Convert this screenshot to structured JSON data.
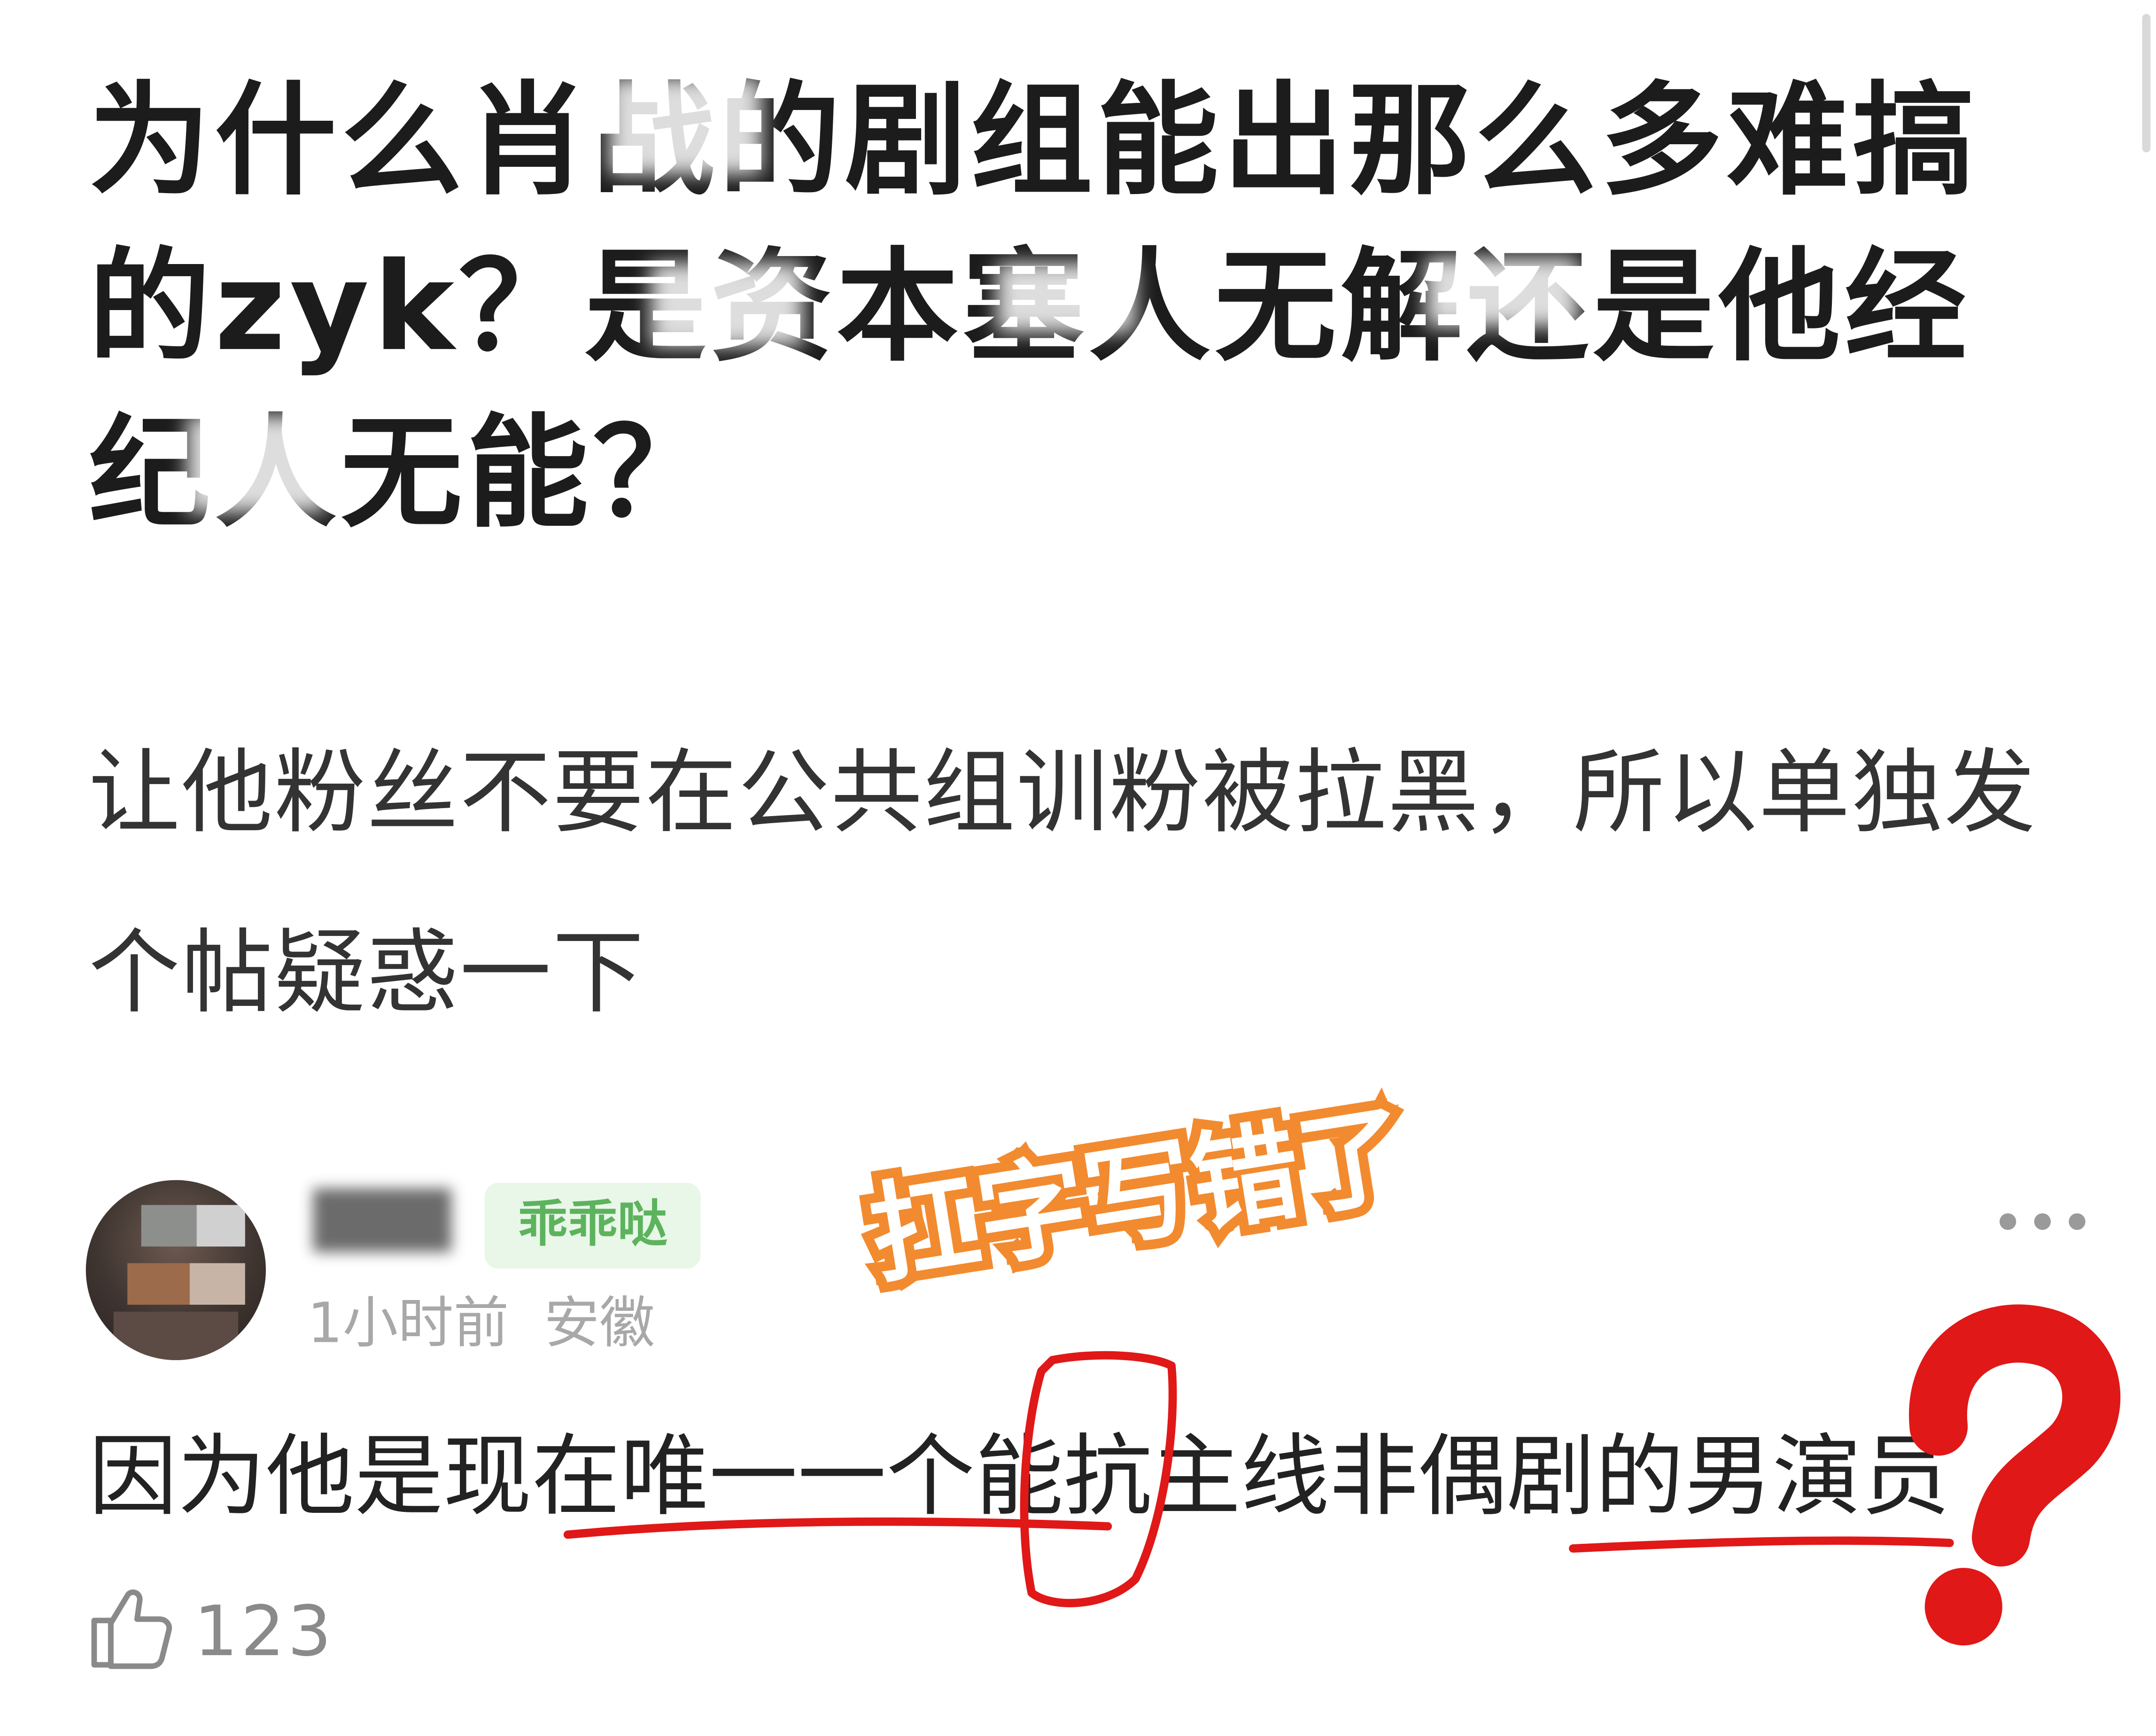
{
  "post": {
    "title": "为什么肖战的剧组能出那么多难搞的zyk？是资本塞人无解还是他经纪人无能？",
    "body": "让他粉丝不要在公共组训粉被拉黑，所以单独发个帖疑惑一下"
  },
  "comment": {
    "badge": "乖乖哒",
    "meta": "1小时前  安徽",
    "text": "因为他是现在唯一一个能抗主线非偶剧的男演员",
    "likes": "123",
    "icons": {
      "more": "more-dots-icon",
      "like": "thumbs-up-icon",
      "avatar": "user-avatar"
    }
  },
  "annotation": {
    "label": "扛字写错了",
    "color": "#f28b30",
    "mark_color": "#e01818",
    "question_mark": "?"
  }
}
